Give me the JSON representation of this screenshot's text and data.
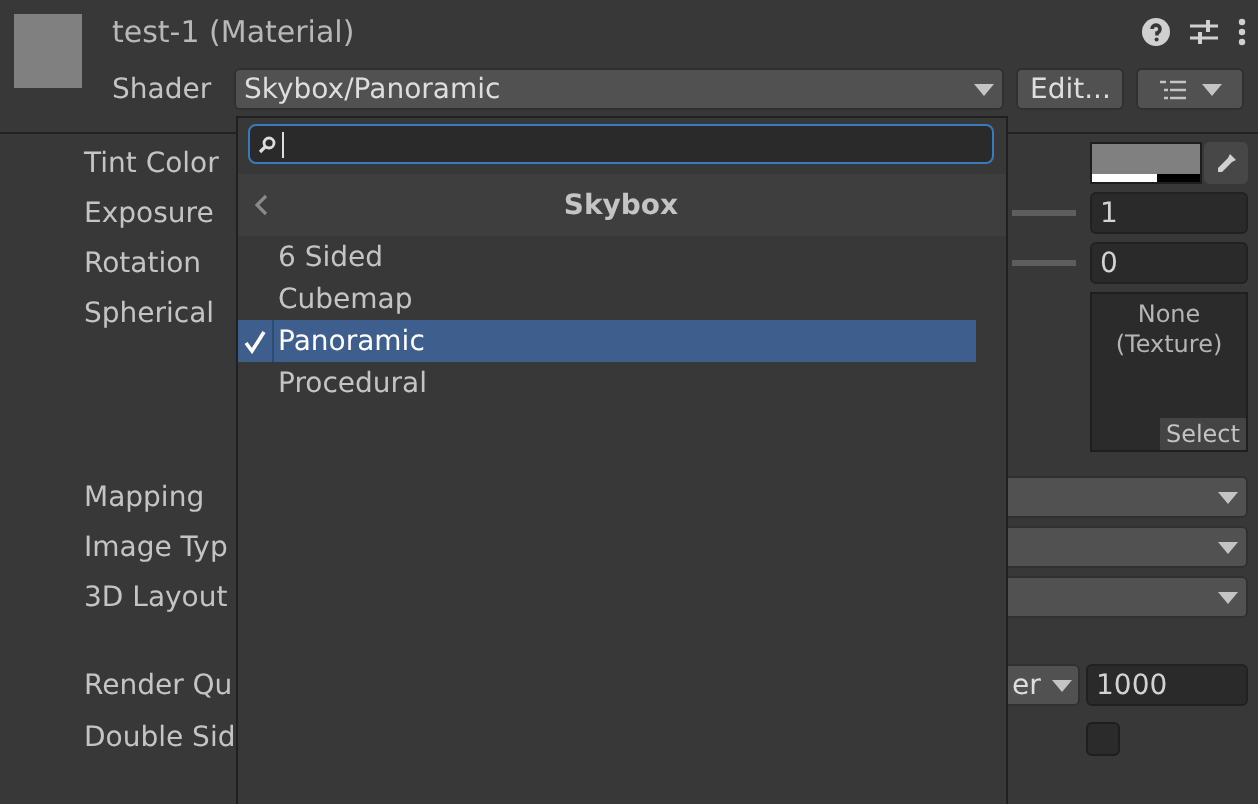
{
  "header": {
    "title": "test-1 (Material)",
    "shader_label": "Shader",
    "shader_value": "Skybox/Panoramic",
    "edit_button": "Edit..."
  },
  "properties": [
    {
      "kind": "color",
      "label": "Tint Color",
      "color": "#808080"
    },
    {
      "kind": "slider",
      "label": "Exposure",
      "value": "1"
    },
    {
      "kind": "slider",
      "label": "Rotation",
      "value": "0"
    },
    {
      "kind": "texture",
      "label": "Spherical",
      "texture_label": "None (Texture)",
      "button": "Select"
    },
    {
      "kind": "dropdown",
      "label": "Mapping"
    },
    {
      "kind": "dropdown",
      "label": "Image Typ"
    },
    {
      "kind": "dropdown",
      "label": "3D Layout"
    },
    {
      "kind": "queue",
      "label": "Render Qu",
      "dropdown": "er",
      "value": "1000"
    },
    {
      "kind": "checkbox",
      "label": "Double Sid",
      "checked": false
    }
  ],
  "popup": {
    "title": "Skybox",
    "items": [
      {
        "label": "6 Sided",
        "selected": false
      },
      {
        "label": "Cubemap",
        "selected": false
      },
      {
        "label": "Panoramic",
        "selected": true
      },
      {
        "label": "Procedural",
        "selected": false
      }
    ]
  }
}
